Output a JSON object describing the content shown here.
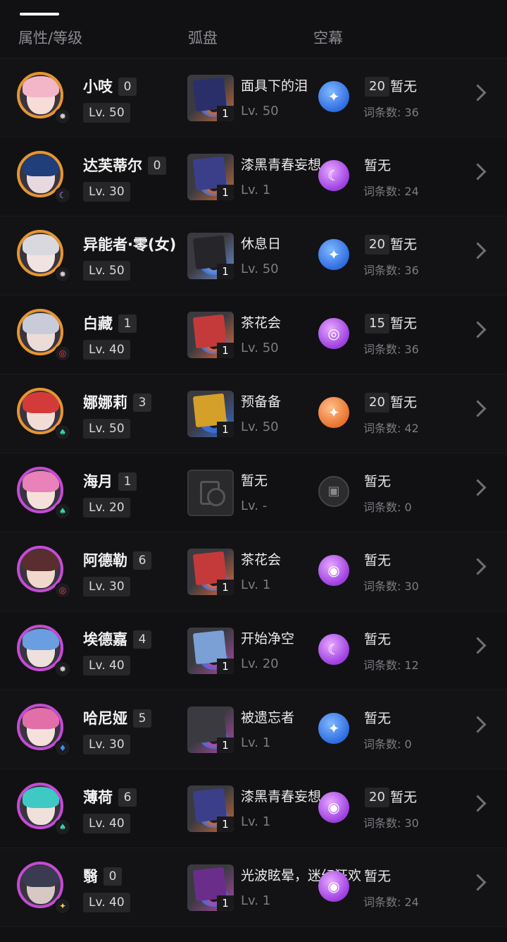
{
  "tabs": {
    "attr_level": "属性/等级",
    "disk": "弧盘",
    "curtain": "空幕"
  },
  "rows": [
    {
      "name": "小吱",
      "rank": "0",
      "level": "Lv. 50",
      "ring": "#e6962f",
      "hair": "#f3b6c8",
      "face": "#f7dcd8",
      "elem_icon": "✸",
      "elem_color": "#d0d0d0",
      "disk": {
        "name": "面具下的泪",
        "level": "Lv. 50",
        "count": "1",
        "c1": "#2a2f6a",
        "c2": "#c96a3a",
        "empty": false
      },
      "curtain": {
        "type": "blue",
        "icon": "✦",
        "badge": "20",
        "status": "暂无",
        "count": "词条数: 36"
      }
    },
    {
      "name": "达芙蒂尔",
      "rank": "0",
      "level": "Lv. 30",
      "ring": "#e6962f",
      "hair": "#1f3e7a",
      "face": "#e8d9e0",
      "elem_icon": "☾",
      "elem_color": "#b9a6ff",
      "disk": {
        "name": "漆黑青春妄想",
        "level": "Lv. 1",
        "count": "1",
        "c1": "#3b3f8a",
        "c2": "#c96a3a",
        "empty": false
      },
      "curtain": {
        "type": "purple",
        "icon": "☾",
        "badge": "",
        "status": "暂无",
        "count": "词条数: 24"
      }
    },
    {
      "name": "异能者·零(女)",
      "rank": "",
      "level": "Lv. 50",
      "ring": "#e6962f",
      "hair": "#d8d8de",
      "face": "#f1e3df",
      "elem_icon": "✸",
      "elem_color": "#d0d0d0",
      "disk": {
        "name": "休息日",
        "level": "Lv. 50",
        "count": "1",
        "c1": "#26262a",
        "c2": "#6f8fd6",
        "empty": false
      },
      "curtain": {
        "type": "blue",
        "icon": "✦",
        "badge": "20",
        "status": "暂无",
        "count": "词条数: 36"
      }
    },
    {
      "name": "白藏",
      "rank": "1",
      "level": "Lv. 40",
      "ring": "#e6962f",
      "hair": "#c9ccd8",
      "face": "#ecdcd8",
      "elem_icon": "◎",
      "elem_color": "#ff3b4a",
      "disk": {
        "name": "茶花会",
        "level": "Lv. 50",
        "count": "1",
        "c1": "#c43a3a",
        "c2": "#e06a40",
        "empty": false
      },
      "curtain": {
        "type": "purple",
        "icon": "◎",
        "badge": "15",
        "status": "暂无",
        "count": "词条数: 36"
      }
    },
    {
      "name": "娜娜莉",
      "rank": "3",
      "level": "Lv. 50",
      "ring": "#e6962f",
      "hair": "#d33a3a",
      "face": "#f2dcd6",
      "elem_icon": "♠",
      "elem_color": "#37d2a8",
      "disk": {
        "name": "预备备",
        "level": "Lv. 50",
        "count": "1",
        "c1": "#d4a02a",
        "c2": "#3a6ad0",
        "empty": false
      },
      "curtain": {
        "type": "orange",
        "icon": "✦",
        "badge": "20",
        "status": "暂无",
        "count": "词条数: 42"
      }
    },
    {
      "name": "海月",
      "rank": "1",
      "level": "Lv. 20",
      "ring": "#c54bd6",
      "hair": "#e882b8",
      "face": "#f5e0dc",
      "elem_icon": "♠",
      "elem_color": "#37d2a8",
      "disk": {
        "name": "暂无",
        "level": "Lv. -",
        "count": "",
        "c1": "",
        "c2": "",
        "empty": true
      },
      "curtain": {
        "type": "gray",
        "icon": "▣",
        "badge": "",
        "status": "暂无",
        "count": "词条数: 0"
      }
    },
    {
      "name": "阿德勒",
      "rank": "6",
      "level": "Lv. 30",
      "ring": "#c54bd6",
      "hair": "#5a2e2e",
      "face": "#f0d8cc",
      "elem_icon": "◎",
      "elem_color": "#ff3b4a",
      "disk": {
        "name": "茶花会",
        "level": "Lv. 1",
        "count": "1",
        "c1": "#c43a3a",
        "c2": "#e06a40",
        "empty": false
      },
      "curtain": {
        "type": "purple",
        "icon": "◉",
        "badge": "",
        "status": "暂无",
        "count": "词条数: 30"
      }
    },
    {
      "name": "埃德嘉",
      "rank": "4",
      "level": "Lv. 40",
      "ring": "#c54bd6",
      "hair": "#6a9ee0",
      "face": "#eee0dc",
      "elem_icon": "✸",
      "elem_color": "#d0d0d0",
      "disk": {
        "name": "开始净空",
        "level": "Lv. 20",
        "count": "1",
        "c1": "#7aa0d6",
        "c2": "#b04aa8",
        "empty": false
      },
      "curtain": {
        "type": "purple",
        "icon": "☾",
        "badge": "",
        "status": "暂无",
        "count": "词条数: 12"
      }
    },
    {
      "name": "哈尼娅",
      "rank": "5",
      "level": "Lv. 30",
      "ring": "#c54bd6",
      "hair": "#e26fa8",
      "face": "#f5e0dc",
      "elem_icon": "♦",
      "elem_color": "#3b8cff",
      "disk": {
        "name": "被遗忘者",
        "level": "Lv. 1",
        "count": "1",
        "c1": "#3a3a40",
        "c2": "#b04aa8",
        "empty": false
      },
      "curtain": {
        "type": "blue",
        "icon": "✦",
        "badge": "",
        "status": "暂无",
        "count": "词条数: 0"
      }
    },
    {
      "name": "薄荷",
      "rank": "6",
      "level": "Lv. 40",
      "ring": "#c54bd6",
      "hair": "#3fc9c4",
      "face": "#f0e0dc",
      "elem_icon": "♠",
      "elem_color": "#37d2a8",
      "disk": {
        "name": "漆黑青春妄想",
        "level": "Lv. 1",
        "count": "1",
        "c1": "#3b3f8a",
        "c2": "#c96a3a",
        "empty": false
      },
      "curtain": {
        "type": "purple",
        "icon": "◉",
        "badge": "20",
        "status": "暂无",
        "count": "词条数: 30"
      }
    },
    {
      "name": "翳",
      "rank": "0",
      "level": "Lv. 40",
      "ring": "#c54bd6",
      "hair": "#3a3a50",
      "face": "#d8c8c4",
      "elem_icon": "✦",
      "elem_color": "#f2c84b",
      "disk": {
        "name": "光波眩晕，迷幻狂欢",
        "level": "Lv. 1",
        "count": "1",
        "c1": "#6a2e8a",
        "c2": "#b04aa8",
        "empty": false
      },
      "curtain": {
        "type": "purple",
        "icon": "◉",
        "badge": "",
        "status": "暂无",
        "count": "词条数: 24"
      }
    }
  ]
}
